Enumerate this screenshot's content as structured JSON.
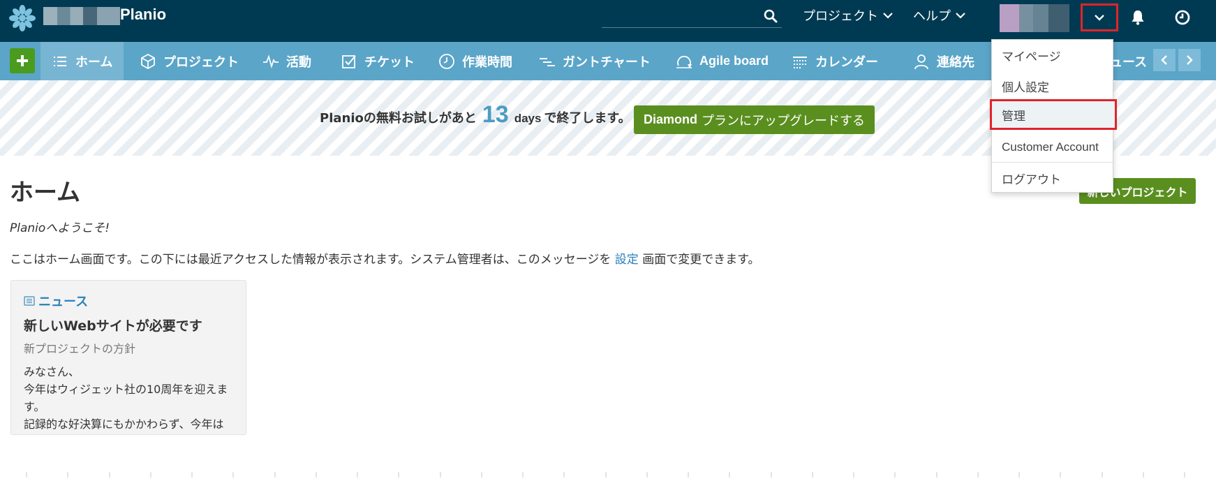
{
  "topbar": {
    "brand": "Planio",
    "projects_menu": "プロジェクト",
    "help_menu": "ヘルプ"
  },
  "nav": {
    "items": [
      {
        "label": "ホーム"
      },
      {
        "label": "プロジェクト"
      },
      {
        "label": "活動"
      },
      {
        "label": "チケット"
      },
      {
        "label": "作業時間"
      },
      {
        "label": "ガントチャート"
      },
      {
        "label": "Agile board"
      },
      {
        "label": "カレンダー"
      },
      {
        "label": "連絡先"
      }
    ],
    "partial_label": "ュース"
  },
  "banner": {
    "prefix": "Planioの無料お試しがあと",
    "days_count": "13",
    "days_unit": "days",
    "suffix": "で終了します。",
    "upgrade_plan": "Diamond",
    "upgrade_text": "プランにアップグレードする"
  },
  "main": {
    "title": "ホーム",
    "new_project_button": "新しいプロジェクト",
    "welcome": "Planioへようこそ!",
    "description_before": "ここはホーム画面です。この下には最近アクセスした情報が表示されます。システム管理者は、このメッセージを",
    "description_link": "設定",
    "description_after": "画面で変更できます。"
  },
  "news": {
    "heading": "ニュース",
    "title": "新しいWebサイトが必要です",
    "subtitle": "新プロジェクトの方針",
    "body_line1": "みなさん、",
    "body_line2": "今年はウィジェット社の10周年を迎えます。",
    "body_line3": "記録的な好決算にもかかわらず、今年は"
  },
  "user_menu": {
    "items": [
      "マイページ",
      "個人設定",
      "管理",
      "Customer Account",
      "ログアウト"
    ]
  },
  "colors": {
    "topbar": "#003a52",
    "navbar": "#5ba5c8",
    "accent_green": "#5a8f1f",
    "link_blue": "#2a81b8",
    "highlight_red": "#e0242a"
  }
}
